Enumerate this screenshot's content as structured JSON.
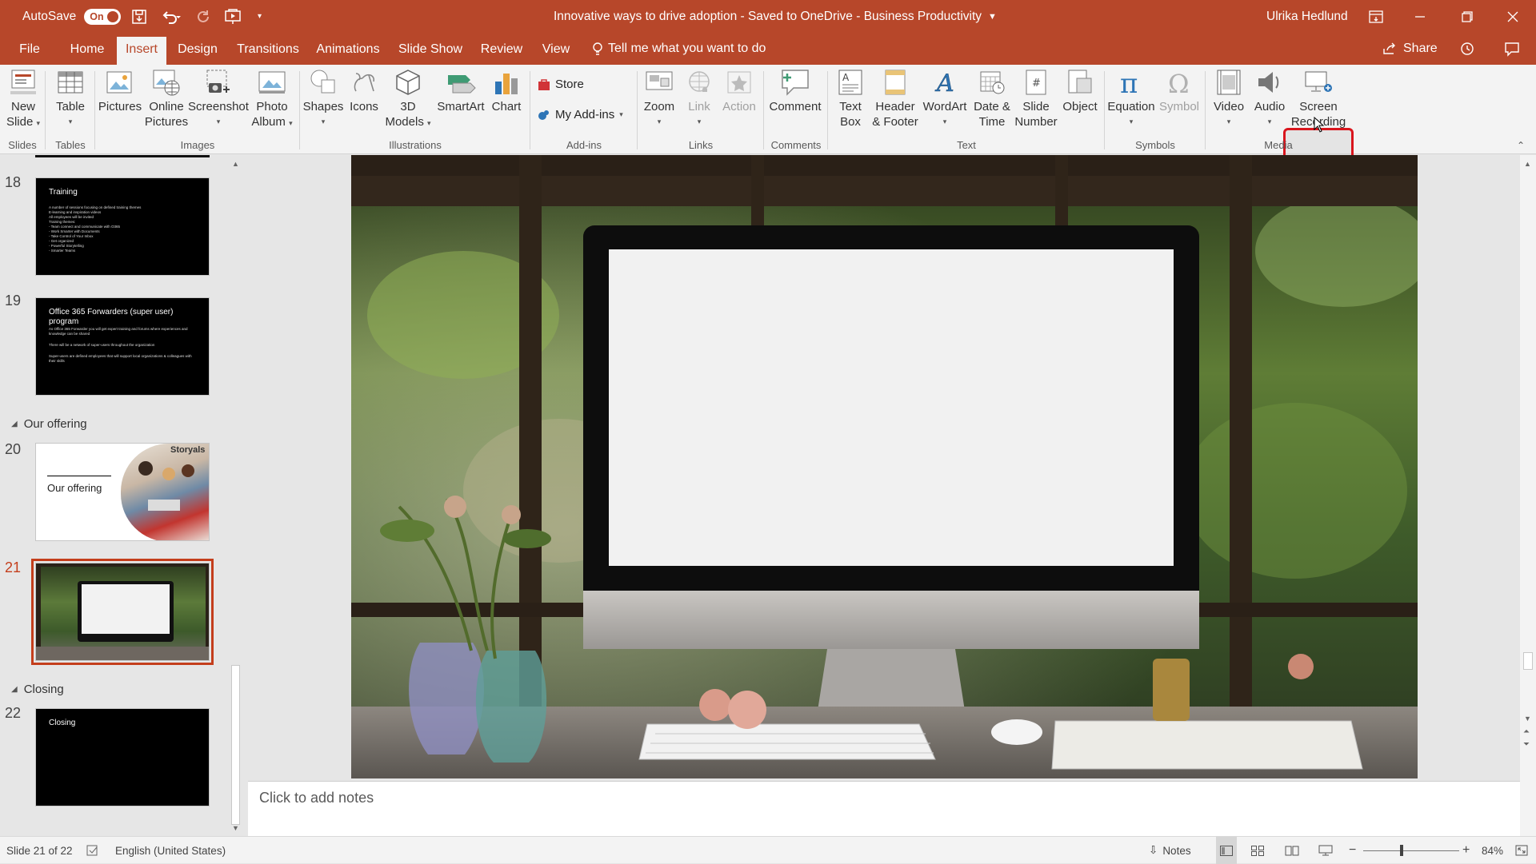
{
  "titlebar": {
    "autosave_label": "AutoSave",
    "autosave_state": "On",
    "doc_title": "Innovative ways to drive adoption  -  Saved to OneDrive - Business Productivity",
    "user_name": "Ulrika Hedlund"
  },
  "tabs": {
    "file": "File",
    "home": "Home",
    "insert": "Insert",
    "design": "Design",
    "transitions": "Transitions",
    "animations": "Animations",
    "slideshow": "Slide Show",
    "review": "Review",
    "view": "View",
    "tellme": "Tell me what you want to do",
    "share": "Share"
  },
  "ribbon": {
    "new_slide": [
      "New",
      "Slide"
    ],
    "table": "Table",
    "pictures": "Pictures",
    "online_pictures": [
      "Online",
      "Pictures"
    ],
    "screenshot": "Screenshot",
    "photo_album": [
      "Photo",
      "Album"
    ],
    "shapes": "Shapes",
    "icons": "Icons",
    "models_3d": [
      "3D",
      "Models"
    ],
    "smartart": "SmartArt",
    "chart": "Chart",
    "store": "Store",
    "my_addins": "My Add-ins",
    "zoom": "Zoom",
    "link": "Link",
    "action": "Action",
    "comment": "Comment",
    "text_box": [
      "Text",
      "Box"
    ],
    "header_footer": [
      "Header",
      "& Footer"
    ],
    "wordart": "WordArt",
    "date_time": [
      "Date &",
      "Time"
    ],
    "slide_number": [
      "Slide",
      "Number"
    ],
    "object": "Object",
    "equation": "Equation",
    "symbol": "Symbol",
    "video": "Video",
    "audio": "Audio",
    "screen_recording": [
      "Screen",
      "Recording"
    ],
    "groups": {
      "slides": "Slides",
      "tables": "Tables",
      "images": "Images",
      "illustrations": "Illustrations",
      "addins": "Add-ins",
      "links": "Links",
      "comments": "Comments",
      "text": "Text",
      "symbols": "Symbols",
      "media": "Media"
    }
  },
  "thumbnails": {
    "slide18": {
      "num": "18",
      "title": "Training",
      "bullets": [
        "A number of sessions focusing on defined training themes",
        "E-learning and inspiration videos",
        "All employees will be invited",
        "Training themes:",
        "  - Team connect and communicate with O365",
        "  - Work Smarter with Documents",
        "  - Take Control of Your Inbox",
        "  - Get organized",
        "  - Powerful Storytelling",
        "  - Smarter Teams"
      ]
    },
    "slide19": {
      "num": "19",
      "title": "Office 365 Forwarders (super user) program",
      "bullets": [
        "As Office 365 Forwarder you will get expert training and forums where experiences and knowledge can be shared",
        "There will be a network of super-users throughout the organization",
        "Super-users are defined employees that will support local organizations & colleagues with their skills"
      ]
    },
    "section_offering": "Our offering",
    "slide20": {
      "num": "20",
      "title": "Our offering",
      "logo": "Storyals"
    },
    "slide21": {
      "num": "21"
    },
    "section_closing": "Closing",
    "slide22": {
      "num": "22",
      "title": "Closing"
    }
  },
  "notes_placeholder": "Click to add notes",
  "status": {
    "slide_info": "Slide 21 of 22",
    "language": "English (United States)",
    "notes": "Notes",
    "zoom": "84%"
  }
}
